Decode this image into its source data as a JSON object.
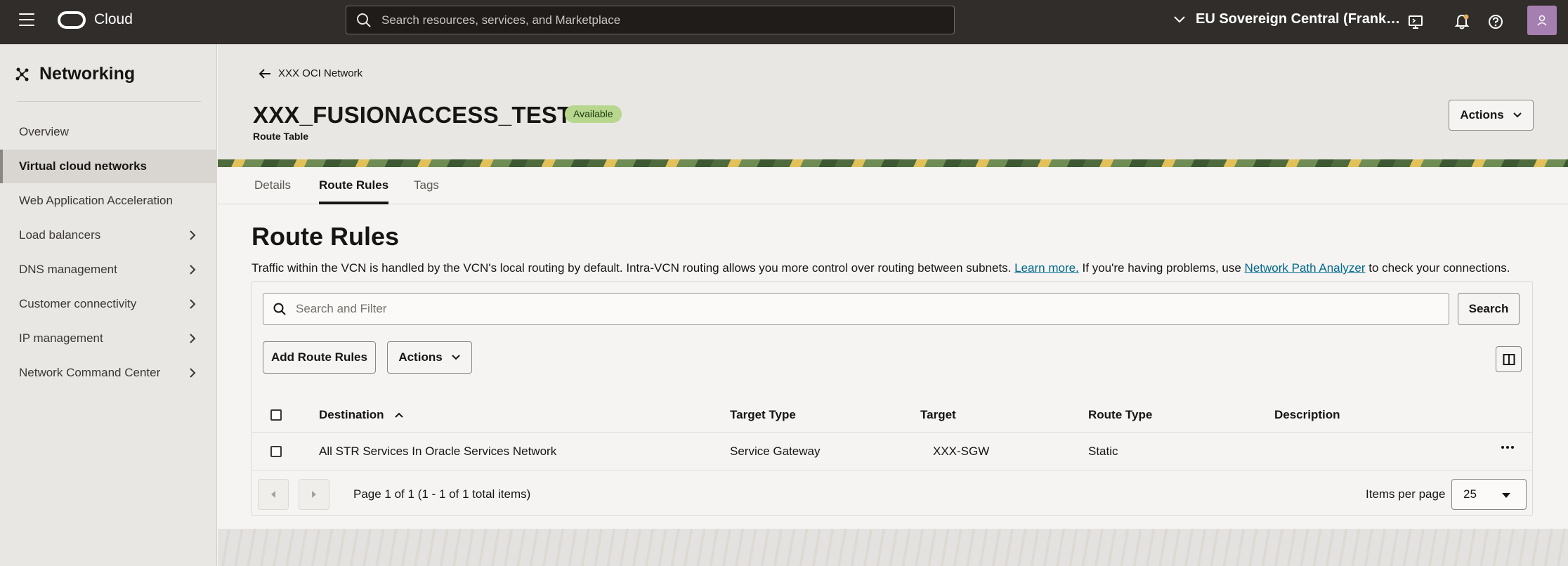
{
  "topbar": {
    "brand": "Cloud",
    "search_placeholder": "Search resources, services, and Marketplace",
    "region": "EU Sovereign Central (Frank…",
    "icons": [
      "menu-icon",
      "oracle-logo",
      "search-icon",
      "chevron-down-icon",
      "cloud-shell-icon",
      "bell-icon",
      "help-icon",
      "user-icon"
    ]
  },
  "sidebar": {
    "title": "Networking",
    "items": [
      {
        "label": "Overview",
        "active": false,
        "expandable": false
      },
      {
        "label": "Virtual cloud networks",
        "active": true,
        "expandable": false
      },
      {
        "label": "Web Application Acceleration",
        "active": false,
        "expandable": false
      },
      {
        "label": "Load balancers",
        "active": false,
        "expandable": true
      },
      {
        "label": "DNS management",
        "active": false,
        "expandable": true
      },
      {
        "label": "Customer connectivity",
        "active": false,
        "expandable": true
      },
      {
        "label": "IP management",
        "active": false,
        "expandable": true
      },
      {
        "label": "Network Command Center",
        "active": false,
        "expandable": true
      }
    ]
  },
  "header": {
    "back_label": "XXX OCI Network",
    "title": "XXX_FUSIONACCESS_TEST",
    "status": "Available",
    "subtitle": "Route Table",
    "actions_label": "Actions"
  },
  "tabs": [
    {
      "label": "Details",
      "active": false
    },
    {
      "label": "Route Rules",
      "active": true
    },
    {
      "label": "Tags",
      "active": false
    }
  ],
  "section": {
    "title": "Route Rules",
    "intro_pre": "Traffic within the VCN is handled by the VCN's local routing by default. Intra-VCN routing allows you more control over routing between subnets.",
    "learn_more": "Learn more.",
    "intro_mid": "If you're having problems, use",
    "analyzer_link": "Network Path Analyzer",
    "intro_post": "to check your connections."
  },
  "filter": {
    "placeholder": "Search and Filter",
    "search_button": "Search"
  },
  "toolbar": {
    "add_label": "Add Route Rules",
    "actions_label": "Actions"
  },
  "table": {
    "columns": [
      "Destination",
      "Target Type",
      "Target",
      "Route Type",
      "Description"
    ],
    "sort": {
      "column": "Destination",
      "direction": "ascending"
    },
    "rows": [
      {
        "destination": "All STR Services In Oracle Services Network",
        "target_type": "Service Gateway",
        "target": "XXX-SGW",
        "route_type": "Static",
        "description": ""
      }
    ]
  },
  "pagination": {
    "info": "Page 1 of 1 (1 - 1 of 1 total items)",
    "items_per_page_label": "Items per page",
    "items_per_page": "25"
  },
  "colors": {
    "topbar": "#312d2a",
    "badge": "#b7d78f",
    "link": "#00688c",
    "avatar": "#a57fb0"
  }
}
